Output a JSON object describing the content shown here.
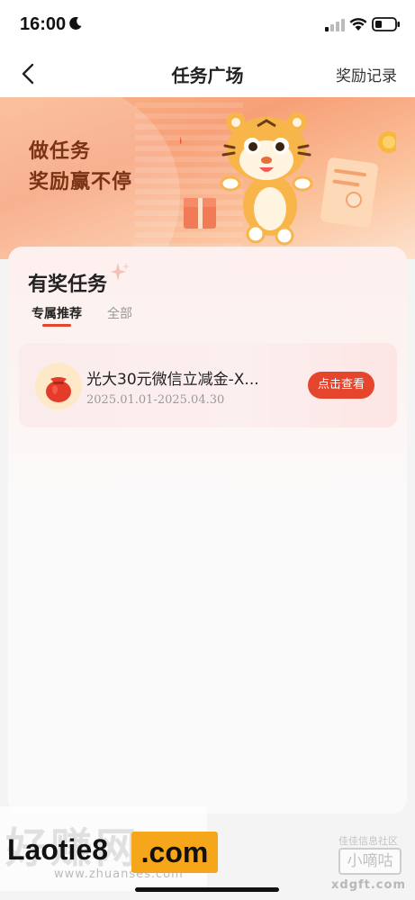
{
  "status_bar": {
    "time": "16:00",
    "icons": [
      "moon-icon",
      "signal-icon",
      "wifi-icon",
      "battery-icon"
    ]
  },
  "nav": {
    "back_icon": "chevron-left-icon",
    "title": "任务广场",
    "right_link": "奖励记录"
  },
  "banner": {
    "line1": "做任务",
    "line2": "奖励赢不停",
    "image": "tiger-mascot-illustration"
  },
  "section": {
    "title": "有奖任务",
    "tabs": [
      {
        "label": "专属推荐",
        "active": true
      },
      {
        "label": "全部",
        "active": false
      }
    ]
  },
  "tasks": [
    {
      "icon": "red-pouch-icon",
      "title": "光大30元微信立减金-X...",
      "date_range": "2025.01.01-2025.04.30",
      "button": "点击查看"
    }
  ],
  "watermarks": {
    "left_faded": "好赚网",
    "left_url": "www.zhuanses.com",
    "left_main": "Laotie8",
    "left_com": ".com",
    "right_top": "佳佳信息社区",
    "right_box": "小嘀咕",
    "right_url": "xdgft.com"
  },
  "colors": {
    "accent": "#e5452d",
    "banner_orange": "#f7a078",
    "watermark_yellow": "#f6a61b"
  }
}
